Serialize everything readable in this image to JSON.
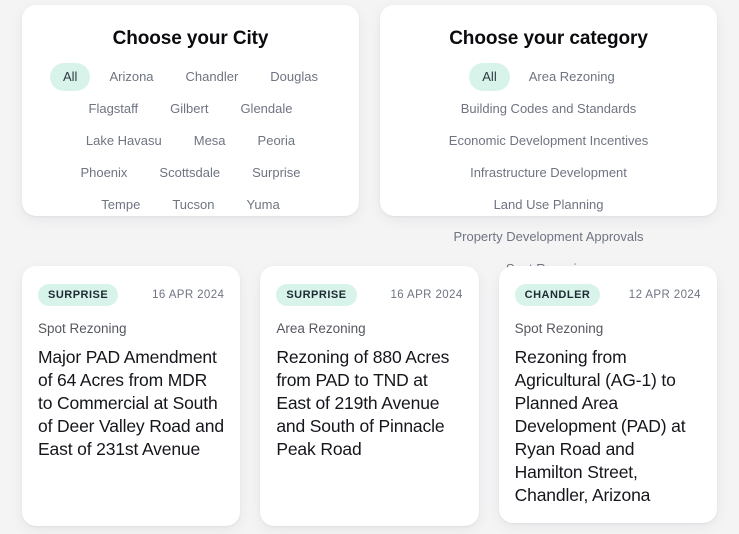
{
  "city_filter": {
    "title": "Choose your City",
    "options": [
      {
        "label": "All",
        "active": true
      },
      {
        "label": "Arizona",
        "active": false
      },
      {
        "label": "Chandler",
        "active": false
      },
      {
        "label": "Douglas",
        "active": false
      },
      {
        "label": "Flagstaff",
        "active": false
      },
      {
        "label": "Gilbert",
        "active": false
      },
      {
        "label": "Glendale",
        "active": false
      },
      {
        "label": "Lake Havasu",
        "active": false
      },
      {
        "label": "Mesa",
        "active": false
      },
      {
        "label": "Peoria",
        "active": false
      },
      {
        "label": "Phoenix",
        "active": false
      },
      {
        "label": "Scottsdale",
        "active": false
      },
      {
        "label": "Surprise",
        "active": false
      },
      {
        "label": "Tempe",
        "active": false
      },
      {
        "label": "Tucson",
        "active": false
      },
      {
        "label": "Yuma",
        "active": false
      }
    ]
  },
  "category_filter": {
    "title": "Choose your category",
    "options": [
      {
        "label": "All",
        "active": true
      },
      {
        "label": "Area Rezoning",
        "active": false
      },
      {
        "label": "Building Codes and Standards",
        "active": false
      },
      {
        "label": "Economic Development Incentives",
        "active": false
      },
      {
        "label": "Infrastructure Development",
        "active": false
      },
      {
        "label": "Land Use Planning",
        "active": false
      },
      {
        "label": "Property Development Approvals",
        "active": false
      },
      {
        "label": "Spot Rezoning",
        "active": false
      }
    ]
  },
  "cards": [
    {
      "city": "SURPRISE",
      "date": "16 APR 2024",
      "category": "Spot Rezoning",
      "title": "Major PAD Amendment of 64 Acres from MDR to Commercial at South of Deer Valley Road and East of 231st Avenue"
    },
    {
      "city": "SURPRISE",
      "date": "16 APR 2024",
      "category": "Area Rezoning",
      "title": "Rezoning of 880 Acres from PAD to TND at East of 219th Avenue and South of Pinnacle Peak Road"
    },
    {
      "city": "CHANDLER",
      "date": "12 APR 2024",
      "category": "Spot Rezoning",
      "title": "Rezoning from Agricultural (AG-1) to Planned Area Development (PAD) at Ryan Road and Hamilton Street, Chandler, Arizona"
    }
  ],
  "colors": {
    "page_background": "#f4f4f5",
    "card_background": "#ffffff",
    "accent_mint": "#d8f3ea",
    "muted_text": "#6e7481",
    "title_text": "#14161c"
  }
}
